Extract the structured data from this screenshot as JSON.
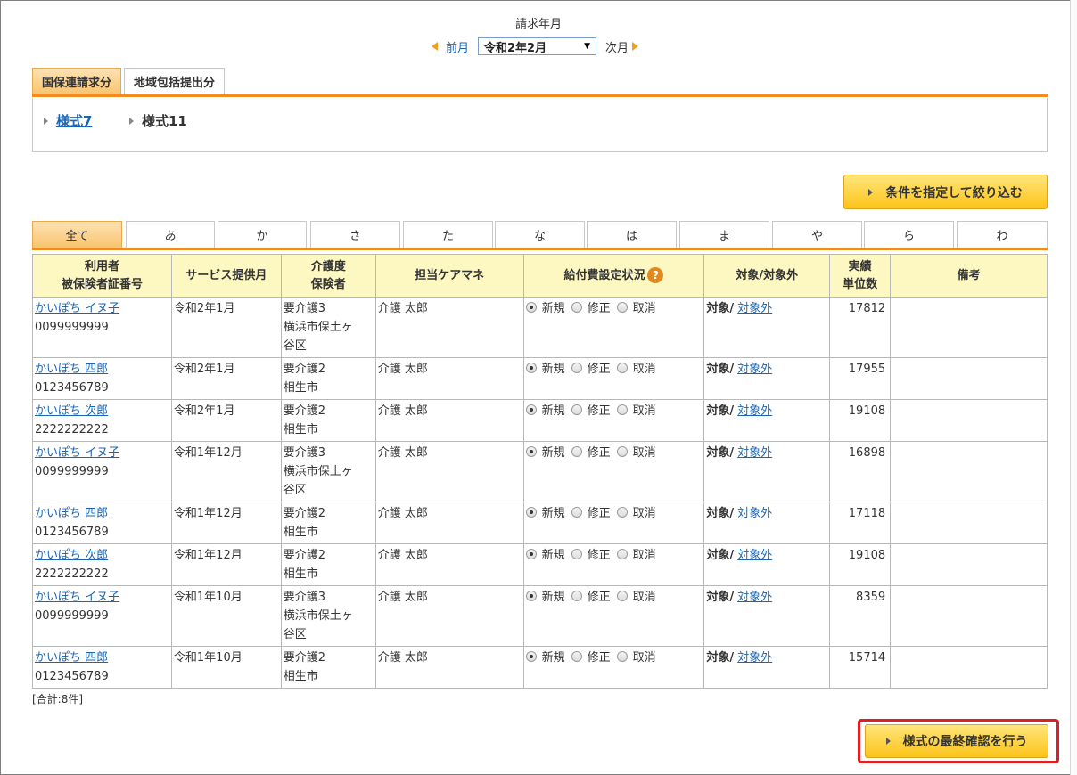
{
  "header": {
    "title": "請求年月",
    "prev_label": "前月",
    "month_value": "令和2年2月",
    "next_label": "次月"
  },
  "report_tabs": [
    {
      "label": "国保連請求分",
      "active": true
    },
    {
      "label": "地域包括提出分",
      "active": false
    }
  ],
  "report_links": {
    "form7": "様式7",
    "form11": "様式11"
  },
  "filter_button": "条件を指定して絞り込む",
  "kana_tabs": [
    "全て",
    "あ",
    "か",
    "さ",
    "た",
    "な",
    "は",
    "ま",
    "や",
    "ら",
    "わ"
  ],
  "table": {
    "headers": {
      "user_line1": "利用者",
      "user_line2": "被保険者証番号",
      "service_month": "サービス提供月",
      "care_line1": "介護度",
      "care_line2": "保険者",
      "manager": "担当ケアマネ",
      "benefit": "給付費設定状況",
      "target": "対象/対象外",
      "units_line1": "実績",
      "units_line2": "単位数",
      "remarks": "備考"
    },
    "radio_labels": [
      "新規",
      "修正",
      "取消"
    ],
    "target_label": "対象/",
    "non_target_label": "対象外",
    "rows": [
      {
        "name": "かいぽち イヌ子",
        "number": "0099999999",
        "month": "令和2年1月",
        "care": "要介護3",
        "insurer": "横浜市保土ヶ谷区",
        "manager": "介護 太郎",
        "units": "17812"
      },
      {
        "name": "かいぽち 四郎",
        "number": "0123456789",
        "month": "令和2年1月",
        "care": "要介護2",
        "insurer": "相生市",
        "manager": "介護 太郎",
        "units": "17955"
      },
      {
        "name": "かいぽち 次郎",
        "number": "2222222222",
        "month": "令和2年1月",
        "care": "要介護2",
        "insurer": "相生市",
        "manager": "介護 太郎",
        "units": "19108"
      },
      {
        "name": "かいぽち イヌ子",
        "number": "0099999999",
        "month": "令和1年12月",
        "care": "要介護3",
        "insurer": "横浜市保土ヶ谷区",
        "manager": "介護 太郎",
        "units": "16898"
      },
      {
        "name": "かいぽち 四郎",
        "number": "0123456789",
        "month": "令和1年12月",
        "care": "要介護2",
        "insurer": "相生市",
        "manager": "介護 太郎",
        "units": "17118"
      },
      {
        "name": "かいぽち 次郎",
        "number": "2222222222",
        "month": "令和1年12月",
        "care": "要介護2",
        "insurer": "相生市",
        "manager": "介護 太郎",
        "units": "19108"
      },
      {
        "name": "かいぽち イヌ子",
        "number": "0099999999",
        "month": "令和1年10月",
        "care": "要介護3",
        "insurer": "横浜市保土ヶ谷区",
        "manager": "介護 太郎",
        "units": "8359"
      },
      {
        "name": "かいぽち 四郎",
        "number": "0123456789",
        "month": "令和1年10月",
        "care": "要介護2",
        "insurer": "相生市",
        "manager": "介護 太郎",
        "units": "15714"
      }
    ]
  },
  "total_label": "[合計:8件]",
  "confirm_button": "様式の最終確認を行う",
  "colors": {
    "accent_orange": "#f28c1e",
    "header_yellow": "#fdf7c2",
    "button_yellow": "#fcc419",
    "highlight_red": "#e02020"
  }
}
